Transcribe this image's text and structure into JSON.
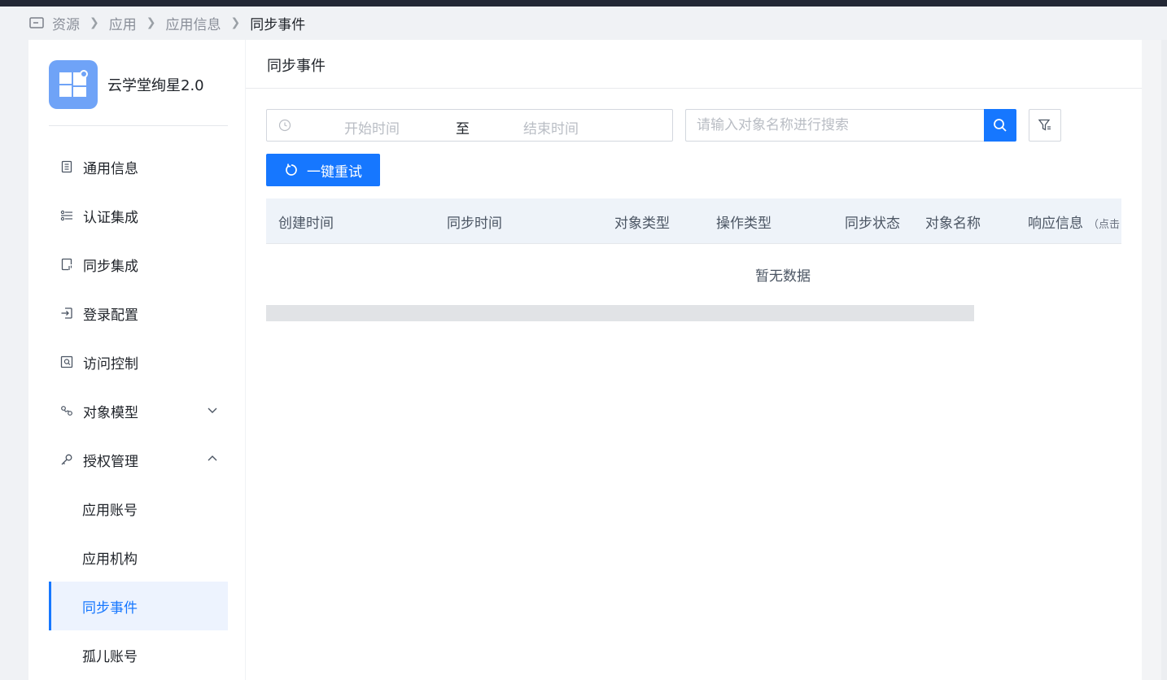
{
  "breadcrumb": {
    "items": [
      "资源",
      "应用",
      "应用信息"
    ],
    "current": "同步事件"
  },
  "app": {
    "name": "云学堂绚星2.0",
    "logo_color": "#6fa3f7"
  },
  "sidebar": {
    "items": [
      {
        "label": "通用信息",
        "icon": "document-icon"
      },
      {
        "label": "认证集成",
        "icon": "sliders-icon"
      },
      {
        "label": "同步集成",
        "icon": "sync-file-icon"
      },
      {
        "label": "登录配置",
        "icon": "login-icon"
      },
      {
        "label": "访问控制",
        "icon": "access-control-icon"
      },
      {
        "label": "对象模型",
        "icon": "model-icon",
        "expanded": false
      },
      {
        "label": "授权管理",
        "icon": "key-icon",
        "expanded": true
      }
    ],
    "sub_items": [
      "应用账号",
      "应用机构",
      "同步事件",
      "孤儿账号"
    ],
    "active": "同步事件"
  },
  "main": {
    "title": "同步事件",
    "date_range": {
      "start_placeholder": "开始时间",
      "separator": "至",
      "end_placeholder": "结束时间"
    },
    "search_placeholder": "请输入对象名称进行搜索",
    "retry_button": "一键重试",
    "table": {
      "columns": [
        "创建时间",
        "同步时间",
        "对象类型",
        "操作类型",
        "同步状态",
        "对象名称",
        "响应信息"
      ],
      "column_hint": "（点击",
      "empty_text": "暂无数据"
    }
  },
  "colors": {
    "accent": "#1677ff",
    "active_bg": "#edf3fe",
    "header_bg": "#eef3f9"
  }
}
